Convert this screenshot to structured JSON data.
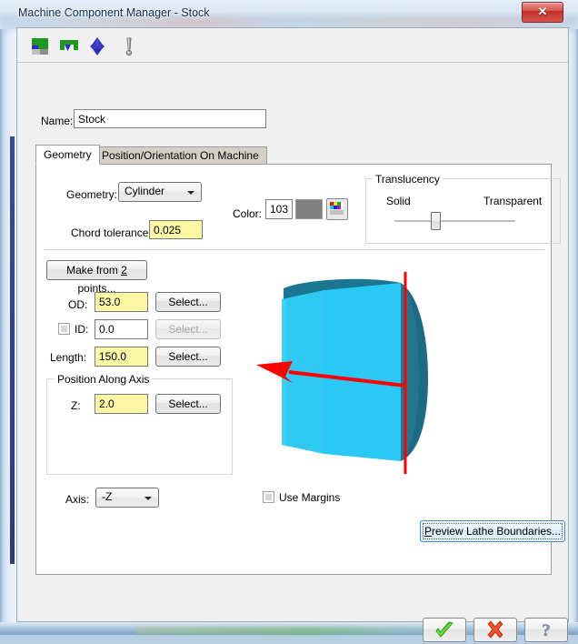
{
  "window": {
    "title": "Machine Component Manager - Stock",
    "close_label": "✕"
  },
  "toolbar": {
    "icons": [
      {
        "name": "stock-from-solid-icon",
        "label": "Stock From Solid"
      },
      {
        "name": "stock-from-profile-icon",
        "label": "Stock From Profile"
      },
      {
        "name": "fixture-icon",
        "label": "Fixture"
      },
      {
        "name": "warning-icon",
        "label": "Warning"
      }
    ]
  },
  "name_row": {
    "label": "Name:",
    "value": "Stock"
  },
  "tabs": [
    {
      "label": "Geometry",
      "active": true
    },
    {
      "label": "Position/Orientation On Machine",
      "active": false
    }
  ],
  "geometry": {
    "geometry_label": "Geometry:",
    "geometry_value": "Cylinder",
    "chord_tolerance_label": "Chord tolerance:",
    "chord_tolerance_value": "0.025",
    "color_label": "Color:",
    "color_value": "103",
    "color_swatch": "#808080",
    "palette_icon": "color-palette-icon"
  },
  "translucency": {
    "title": "Translucency",
    "solid_label": "Solid",
    "transparent_label": "Transparent",
    "slider_position_pct": 30
  },
  "dimensions": {
    "make_from_points_label": "Make from 2 points...",
    "make_from_points_mnemonic": "2",
    "od_label": "OD:",
    "od_value": "53.0",
    "od_select_label": "Select...",
    "id_label": "ID:",
    "id_value": "0.0",
    "id_select_label": "Select...",
    "id_checked": false,
    "length_label": "Length:",
    "length_value": "150.0",
    "length_select_label": "Select..."
  },
  "position_along_axis": {
    "title": "Position Along Axis",
    "z_label": "Z:",
    "z_value": "2.0",
    "z_select_label": "Select..."
  },
  "axis": {
    "label": "Axis:",
    "value": "-Z"
  },
  "use_margins": {
    "label": "Use Margins",
    "checked": false
  },
  "preview_button": {
    "label": "Preview Lathe Boundaries...",
    "mnemonic": "P"
  },
  "preview_3d": {
    "body_color": "#29c8f5",
    "shade_color": "#1d6a86",
    "axis_color": "#ff0000"
  },
  "footer": {
    "ok_label": "ok-check-icon",
    "cancel_label": "cancel-x-icon",
    "help_label": "help-question-icon"
  }
}
